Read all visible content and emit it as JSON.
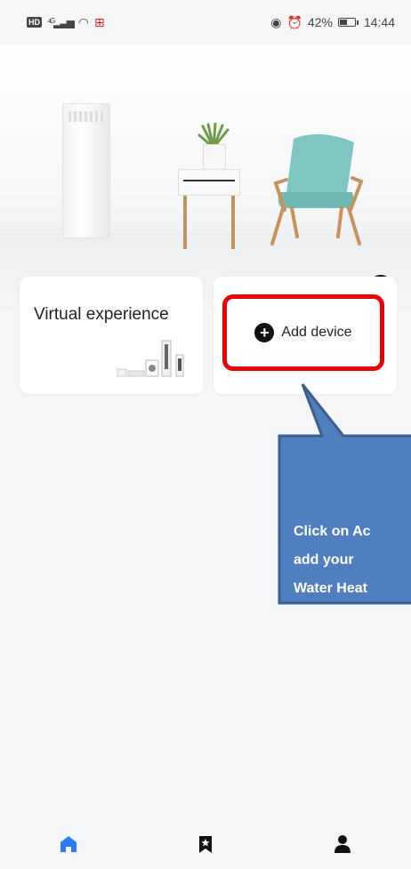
{
  "status_bar": {
    "network": "4G",
    "battery_percent": "42%",
    "time": "14:44"
  },
  "hero": {
    "add_button_symbol": "+"
  },
  "cards": {
    "virtual": {
      "title": "Virtual experience"
    },
    "add": {
      "label": "Add device",
      "icon": "+"
    }
  },
  "callout": {
    "lines": [
      "Click on Ac",
      "add your",
      "Water Heat"
    ]
  },
  "bottom_nav": {
    "items": [
      {
        "name": "home",
        "icon": "home-icon",
        "active": true
      },
      {
        "name": "scenes",
        "icon": "bookmark-star-icon",
        "active": false
      },
      {
        "name": "profile",
        "icon": "person-icon",
        "active": false
      }
    ]
  },
  "colors": {
    "accent": "#2d7cf6",
    "highlight_border": "#ee0000",
    "callout_fill": "#4f7fbf",
    "callout_border": "#3c5f8a",
    "icon_dark": "#111111"
  }
}
